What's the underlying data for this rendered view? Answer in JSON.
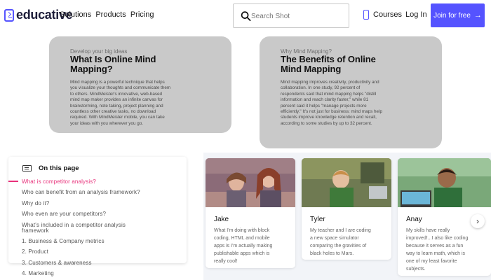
{
  "header": {
    "logo_text": "educative",
    "nav_links": [
      "Solutions",
      "Products",
      "Pricing"
    ],
    "search_placeholder": "Search Shot",
    "courses_label": "Courses",
    "login_label": "Log In",
    "join_label": "Join for free",
    "join_arrow": "→"
  },
  "cards": [
    {
      "eyebrow": "Develop your big ideas",
      "title_lines": [
        "What Is Online Mind",
        "Mapping?"
      ],
      "body_lines": [
        "Mind mapping is a powerful technique that helps",
        "you visualize your thoughts and communicate them",
        "to others. MindMeister's innovative, web-based",
        "mind map maker provides an infinite canvas for",
        "brainstorming, note taking, project planning and",
        "countless other creative tasks, no download",
        "required. With MindMeister mobile, you can take",
        "your ideas with you wherever you go."
      ]
    },
    {
      "eyebrow": "Why Mind Mapping?",
      "title_lines": [
        "The Benefits of Online",
        "Mind Mapping"
      ],
      "body_lines": [
        "Mind mapping improves creativity, productivity and",
        "collaboration. In one study, 92 percent of",
        "respondents said that mind mapping helps \"distill",
        "information and reach clarity faster,\" while 81",
        "percent said it helps \"manage projects more",
        "efficiently.\" It's not just for business: mind maps help",
        "students improve knowledge retention and recall,",
        "according to some studies by up to 32 percent."
      ]
    }
  ],
  "toc": {
    "title": "On this page",
    "items": [
      "What is competitor analysis?",
      "Who can benefit from an analysis framework?",
      "Why do it?",
      "Who even are your competitors?",
      "What's included in a competitor analysis",
      "framework",
      "1. Business & Company metrics",
      "2. Product",
      "3. Customers & awareness",
      "4. Marketing"
    ],
    "active_index": 0
  },
  "testimonials": [
    {
      "name": "Jake",
      "quote_lines": [
        "What I'm doing with block",
        "coding, HTML and mobile",
        "apps is I'm actually making",
        "publishable apps which is",
        "really cool!"
      ]
    },
    {
      "name": "Tyler",
      "quote_lines": [
        "My teacher and I are coding",
        "a new space simulator",
        "comparing the gravities of",
        "black holes to Mars."
      ]
    },
    {
      "name": "Anay",
      "quote_lines": [
        "My skills have really",
        "improved!...I also like coding",
        "because it serves as a fun",
        "way to learn math, which is",
        "one of my least favorite",
        "subjects."
      ]
    }
  ],
  "carousel_next_glyph": "›"
}
